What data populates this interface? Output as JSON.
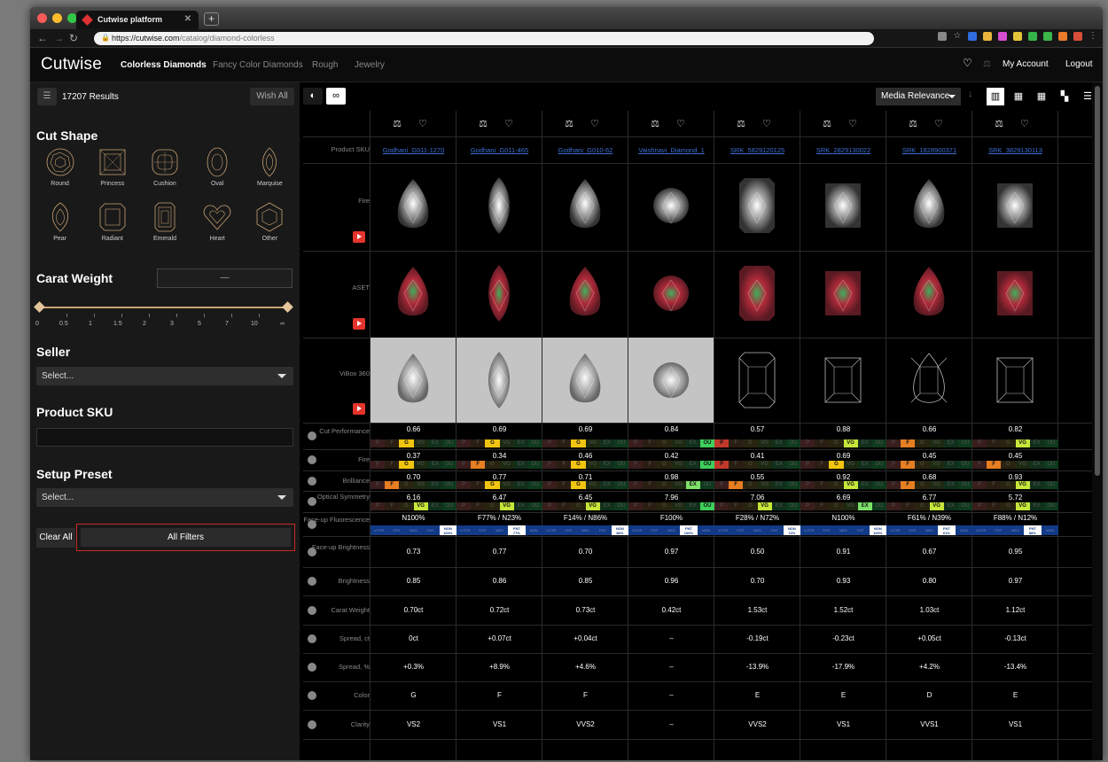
{
  "browser": {
    "tab_title": "Cutwise platform",
    "url_host": "https://cutwise.com",
    "url_path": "/catalog/diamond-colorless"
  },
  "nav": {
    "logo": "Cutwise",
    "items": [
      "Colorless Diamonds",
      "Fancy Color Diamonds",
      "Rough",
      "Jewelry"
    ],
    "account": "My Account",
    "logout": "Logout"
  },
  "sidebar": {
    "results": "17207 Results",
    "wish_all": "Wish All",
    "cut_shape_title": "Cut Shape",
    "shapes": [
      "Round",
      "Princess",
      "Cushion",
      "Oval",
      "Marquise",
      "Pear",
      "Radiant",
      "Emerald",
      "Heart",
      "Other"
    ],
    "carat_title": "Carat Weight",
    "carat_value": "—",
    "carat_ticks": [
      "0",
      "0.5",
      "1",
      "1.5",
      "2",
      "3",
      "5",
      "7",
      "10",
      "∞"
    ],
    "seller_title": "Seller",
    "seller_select": "Select...",
    "sku_title": "Product SKU",
    "setup_title": "Setup Preset",
    "setup_select": "Select...",
    "clear_all": "Clear All",
    "all_filters": "All Filters"
  },
  "toolbar": {
    "sort": "Media Relevance"
  },
  "grid": {
    "row_labels": {
      "sku": "Product SKU",
      "fire": "Fire",
      "aset": "ASET",
      "vibox": "ViBox 360",
      "cut": "Cut Performance",
      "fire2": "Fire",
      "brilliance": "Brilliance",
      "optical": "Optical Symmetry",
      "fluor": "Face-up Fluorescence",
      "fubright": "Face-up Brightness",
      "bright": "Brightness",
      "carat": "Carat Weight",
      "spreadct": "Spread, ct",
      "spreadpct": "Spread, %",
      "color": "Color",
      "clarity": "Clarity"
    },
    "grade_scale": [
      "P",
      "F",
      "G",
      "VG",
      "EX",
      "OU"
    ],
    "fluor_scale": [
      "V.STR",
      "STR",
      "MED",
      "FNT",
      "NON"
    ],
    "columns": [
      {
        "sku": "Godhani_G011-1270",
        "shape": "pear",
        "cut": "0.66",
        "cut_g": "G",
        "fire": "0.37",
        "fire_g": "G",
        "bril": "0.70",
        "bril_g": "F",
        "opt": "6.16",
        "opt_g": "VG",
        "fluor": "N100%",
        "fluor_hit": "NON",
        "fluor_sub": "100%",
        "fub": "0.73",
        "br": "0.85",
        "carat": "0.70ct",
        "sct": "0ct",
        "spct": "+0.3%",
        "color": "G",
        "clarity": "VS2"
      },
      {
        "sku": "Godhani_G011-465",
        "shape": "marquise",
        "cut": "0.69",
        "cut_g": "G",
        "fire": "0.34",
        "fire_g": "F",
        "bril": "0.77",
        "bril_g": "G",
        "opt": "6.47",
        "opt_g": "VG",
        "fluor": "F77% / N23%",
        "fluor_hit": "FNT",
        "fluor_sub": "77%",
        "fub": "0.77",
        "br": "0.86",
        "carat": "0.72ct",
        "sct": "+0.07ct",
        "spct": "+8.9%",
        "color": "F",
        "clarity": "VS1"
      },
      {
        "sku": "Godhani_G010-62",
        "shape": "pear",
        "cut": "0.69",
        "cut_g": "G",
        "fire": "0.46",
        "fire_g": "G",
        "bril": "0.71",
        "bril_g": "G",
        "opt": "6.45",
        "opt_g": "VG",
        "fluor": "F14% / N86%",
        "fluor_hit": "NON",
        "fluor_sub": "86%",
        "fub": "0.70",
        "br": "0.85",
        "carat": "0.73ct",
        "sct": "+0.04ct",
        "spct": "+4.6%",
        "color": "F",
        "clarity": "VVS2"
      },
      {
        "sku": "Vaishnavi_Diamond_1",
        "shape": "round",
        "cut": "0.84",
        "cut_g": "OU",
        "fire": "0.42",
        "fire_g": "OU",
        "bril": "0.98",
        "bril_g": "EX",
        "opt": "7.96",
        "opt_g": "OU",
        "fluor": "F100%",
        "fluor_hit": "FNT",
        "fluor_sub": "100%",
        "fub": "0.97",
        "br": "0.96",
        "carat": "0.42ct",
        "sct": "–",
        "spct": "–",
        "color": "–",
        "clarity": "–"
      },
      {
        "sku": "SRK_5829120125",
        "shape": "emerald",
        "cut": "0.57",
        "cut_g": "P",
        "fire": "0.41",
        "fire_g": "P",
        "bril": "0.55",
        "bril_g": "F",
        "opt": "7.06",
        "opt_g": "VG",
        "fluor": "F28% / N72%",
        "fluor_hit": "NON",
        "fluor_sub": "72%",
        "fub": "0.50",
        "br": "0.70",
        "carat": "1.53ct",
        "sct": "-0.19ct",
        "spct": "-13.9%",
        "color": "E",
        "clarity": "VVS2"
      },
      {
        "sku": "SRK_2829130022",
        "shape": "princess",
        "cut": "0.88",
        "cut_g": "VG",
        "fire": "0.69",
        "fire_g": "G",
        "bril": "0.92",
        "bril_g": "VG",
        "opt": "6.69",
        "opt_g": "EX",
        "fluor": "N100%",
        "fluor_hit": "NON",
        "fluor_sub": "100%",
        "fub": "0.91",
        "br": "0.93",
        "carat": "1.52ct",
        "sct": "-0.23ct",
        "spct": "-17.9%",
        "color": "E",
        "clarity": "VS1"
      },
      {
        "sku": "SRK_1828900371",
        "shape": "pear",
        "cut": "0.66",
        "cut_g": "F",
        "fire": "0.45",
        "fire_g": "F",
        "bril": "0.68",
        "bril_g": "F",
        "opt": "6.77",
        "opt_g": "VG",
        "fluor": "F61% / N39%",
        "fluor_hit": "FNT",
        "fluor_sub": "61%",
        "fub": "0.67",
        "br": "0.80",
        "carat": "1.03ct",
        "sct": "+0.05ct",
        "spct": "+4.2%",
        "color": "D",
        "clarity": "VVS1"
      },
      {
        "sku": "SRK_3829130113",
        "shape": "princess",
        "cut": "0.82",
        "cut_g": "VG",
        "fire": "0.45",
        "fire_g": "F",
        "bril": "0.93",
        "bril_g": "VG",
        "opt": "5.72",
        "opt_g": "VG",
        "fluor": "F88% / N12%",
        "fluor_hit": "FNT",
        "fluor_sub": "88%",
        "fub": "0.95",
        "br": "0.97",
        "carat": "1.12ct",
        "sct": "-0.13ct",
        "spct": "-13.4%",
        "color": "E",
        "clarity": "VS1"
      }
    ]
  }
}
